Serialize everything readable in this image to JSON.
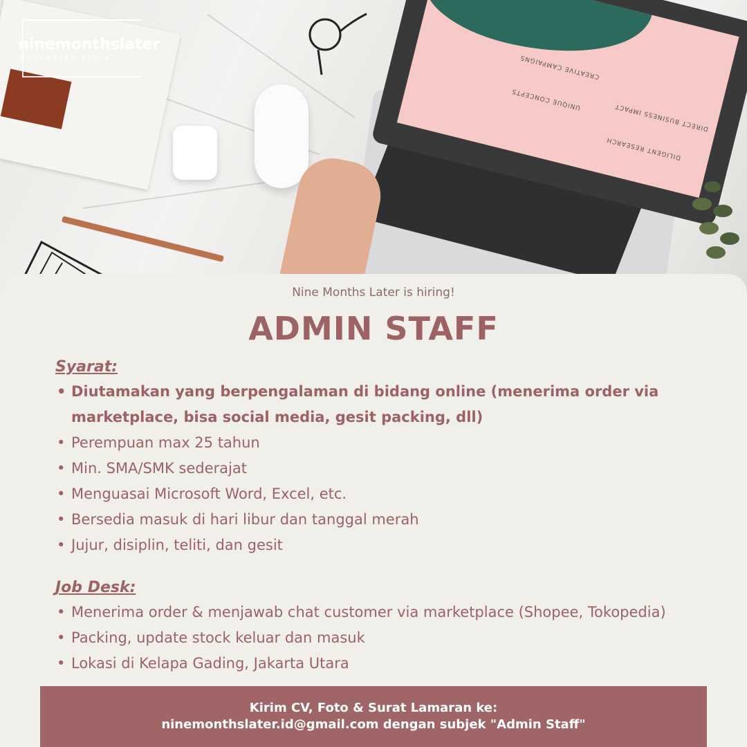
{
  "logo": {
    "name": "ninemonthslater",
    "tagline": "baby&kids store"
  },
  "screen": {
    "items": [
      "CREATIVE CAMPAIGNS",
      "UNIQUE CONCEPTS",
      "DIRECT BUSINESS IMPACT",
      "DILIGENT RESEARCH"
    ]
  },
  "hiring_line": "Nine Months Later is hiring!",
  "title": "ADMIN STAFF",
  "syarat": {
    "heading": "Syarat:",
    "items": [
      "Diutamakan yang berpengalaman di bidang online (menerima order via marketplace, bisa social media, gesit packing, dll)",
      "Perempuan max 25 tahun",
      "Min. SMA/SMK sederajat",
      "Menguasai Microsoft Word, Excel, etc.",
      "Bersedia masuk di hari libur dan tanggal merah",
      "Jujur, disiplin, teliti, dan gesit"
    ]
  },
  "jobdesk": {
    "heading": "Job Desk:",
    "items": [
      "Menerima order & menjawab chat customer via marketplace (Shopee, Tokopedia)",
      "Packing, update stock keluar dan masuk",
      "Lokasi di Kelapa Gading, Jakarta Utara"
    ]
  },
  "footer": {
    "line1": "Kirim CV, Foto & Surat Lamaran ke:",
    "line2": "ninemonthslater.id@gmail.com dengan subjek \"Admin Staff\""
  },
  "colors": {
    "accent": "#9c6264",
    "footer_bg": "#a06566",
    "card_bg": "#f0efea"
  }
}
